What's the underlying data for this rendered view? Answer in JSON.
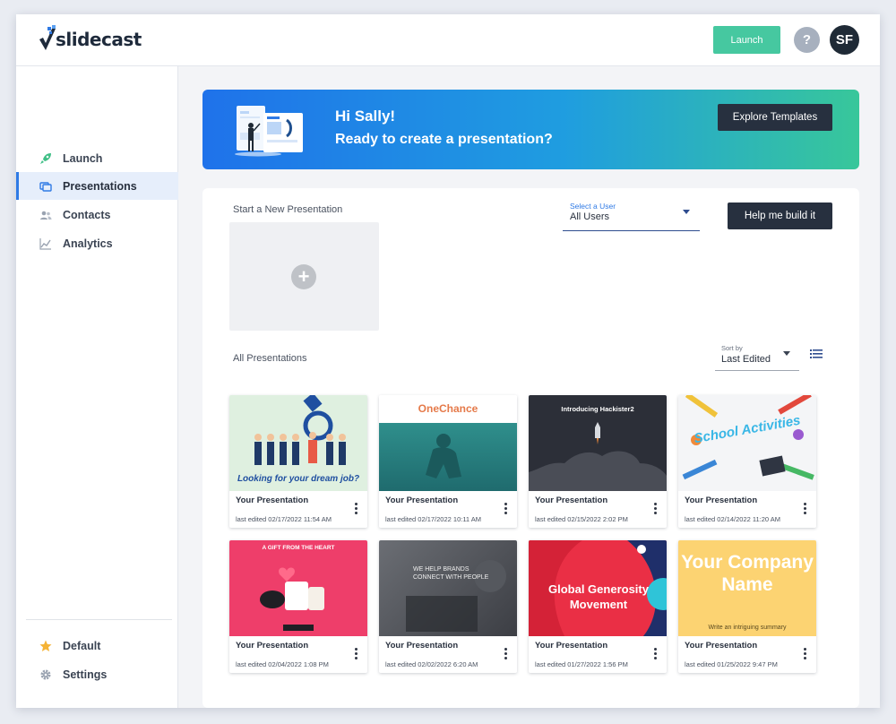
{
  "app": {
    "logo_text": "slidecast",
    "launch_label": "Launch",
    "help_label": "?",
    "avatar_initials": "SF"
  },
  "colors": {
    "accent": "#2f7ae5",
    "launch_green": "#46c8a0",
    "dark_button": "#27303f"
  },
  "sidebar": {
    "items": [
      {
        "label": "Launch",
        "icon": "rocket-icon"
      },
      {
        "label": "Presentations",
        "icon": "presentations-icon",
        "active": true
      },
      {
        "label": "Contacts",
        "icon": "contacts-icon"
      },
      {
        "label": "Analytics",
        "icon": "analytics-icon"
      }
    ],
    "bottom": [
      {
        "label": "Default",
        "icon": "star-icon"
      },
      {
        "label": "Settings",
        "icon": "gear-icon"
      }
    ]
  },
  "banner": {
    "greeting": "Hi Sally!",
    "subtitle": "Ready to create a presentation?",
    "explore_label": "Explore Templates"
  },
  "main": {
    "start_label": "Start a New Presentation",
    "new_plus": "+",
    "select_user_label": "Select a User",
    "select_user_value": "All Users",
    "help_build_label": "Help me build it",
    "all_label": "All Presentations",
    "sort_label": "Sort by",
    "sort_value": "Last Edited"
  },
  "presentations": [
    {
      "title": "Your Presentation",
      "date": "last edited 02/17/2022 11:54 AM",
      "thumb_text": "Looking for your dream job?"
    },
    {
      "title": "Your Presentation",
      "date": "last edited 02/17/2022 10:11 AM",
      "thumb_text": "OneChance"
    },
    {
      "title": "Your Presentation",
      "date": "last edited 02/15/2022 2:02 PM",
      "thumb_text": "Introducing Hackister2"
    },
    {
      "title": "Your Presentation",
      "date": "last edited 02/14/2022 11:20 AM",
      "thumb_text": "School Activities"
    },
    {
      "title": "Your Presentation",
      "date": "last edited 02/04/2022 1:08 PM",
      "thumb_text": "A GIFT FROM THE HEART"
    },
    {
      "title": "Your Presentation",
      "date": "last edited 02/02/2022 6:20 AM",
      "thumb_text": "WE HELP BRANDS CONNECT WITH PEOPLE"
    },
    {
      "title": "Your Presentation",
      "date": "last edited 01/27/2022 1:56 PM",
      "thumb_text": "Global Generosity Movement"
    },
    {
      "title": "Your Presentation",
      "date": "last edited 01/25/2022 9:47 PM",
      "thumb_text": "Your Company Name",
      "thumb_sub": "Write an intriguing summary"
    }
  ]
}
